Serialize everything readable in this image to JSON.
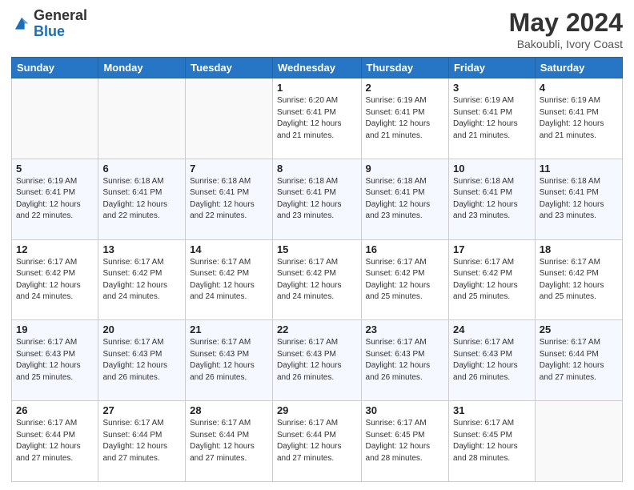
{
  "logo": {
    "general": "General",
    "blue": "Blue"
  },
  "header": {
    "title": "May 2024",
    "location": "Bakoubli, Ivory Coast"
  },
  "weekdays": [
    "Sunday",
    "Monday",
    "Tuesday",
    "Wednesday",
    "Thursday",
    "Friday",
    "Saturday"
  ],
  "weeks": [
    [
      {
        "day": "",
        "info": ""
      },
      {
        "day": "",
        "info": ""
      },
      {
        "day": "",
        "info": ""
      },
      {
        "day": "1",
        "info": "Sunrise: 6:20 AM\nSunset: 6:41 PM\nDaylight: 12 hours\nand 21 minutes."
      },
      {
        "day": "2",
        "info": "Sunrise: 6:19 AM\nSunset: 6:41 PM\nDaylight: 12 hours\nand 21 minutes."
      },
      {
        "day": "3",
        "info": "Sunrise: 6:19 AM\nSunset: 6:41 PM\nDaylight: 12 hours\nand 21 minutes."
      },
      {
        "day": "4",
        "info": "Sunrise: 6:19 AM\nSunset: 6:41 PM\nDaylight: 12 hours\nand 21 minutes."
      }
    ],
    [
      {
        "day": "5",
        "info": "Sunrise: 6:19 AM\nSunset: 6:41 PM\nDaylight: 12 hours\nand 22 minutes."
      },
      {
        "day": "6",
        "info": "Sunrise: 6:18 AM\nSunset: 6:41 PM\nDaylight: 12 hours\nand 22 minutes."
      },
      {
        "day": "7",
        "info": "Sunrise: 6:18 AM\nSunset: 6:41 PM\nDaylight: 12 hours\nand 22 minutes."
      },
      {
        "day": "8",
        "info": "Sunrise: 6:18 AM\nSunset: 6:41 PM\nDaylight: 12 hours\nand 23 minutes."
      },
      {
        "day": "9",
        "info": "Sunrise: 6:18 AM\nSunset: 6:41 PM\nDaylight: 12 hours\nand 23 minutes."
      },
      {
        "day": "10",
        "info": "Sunrise: 6:18 AM\nSunset: 6:41 PM\nDaylight: 12 hours\nand 23 minutes."
      },
      {
        "day": "11",
        "info": "Sunrise: 6:18 AM\nSunset: 6:41 PM\nDaylight: 12 hours\nand 23 minutes."
      }
    ],
    [
      {
        "day": "12",
        "info": "Sunrise: 6:17 AM\nSunset: 6:42 PM\nDaylight: 12 hours\nand 24 minutes."
      },
      {
        "day": "13",
        "info": "Sunrise: 6:17 AM\nSunset: 6:42 PM\nDaylight: 12 hours\nand 24 minutes."
      },
      {
        "day": "14",
        "info": "Sunrise: 6:17 AM\nSunset: 6:42 PM\nDaylight: 12 hours\nand 24 minutes."
      },
      {
        "day": "15",
        "info": "Sunrise: 6:17 AM\nSunset: 6:42 PM\nDaylight: 12 hours\nand 24 minutes."
      },
      {
        "day": "16",
        "info": "Sunrise: 6:17 AM\nSunset: 6:42 PM\nDaylight: 12 hours\nand 25 minutes."
      },
      {
        "day": "17",
        "info": "Sunrise: 6:17 AM\nSunset: 6:42 PM\nDaylight: 12 hours\nand 25 minutes."
      },
      {
        "day": "18",
        "info": "Sunrise: 6:17 AM\nSunset: 6:42 PM\nDaylight: 12 hours\nand 25 minutes."
      }
    ],
    [
      {
        "day": "19",
        "info": "Sunrise: 6:17 AM\nSunset: 6:43 PM\nDaylight: 12 hours\nand 25 minutes."
      },
      {
        "day": "20",
        "info": "Sunrise: 6:17 AM\nSunset: 6:43 PM\nDaylight: 12 hours\nand 26 minutes."
      },
      {
        "day": "21",
        "info": "Sunrise: 6:17 AM\nSunset: 6:43 PM\nDaylight: 12 hours\nand 26 minutes."
      },
      {
        "day": "22",
        "info": "Sunrise: 6:17 AM\nSunset: 6:43 PM\nDaylight: 12 hours\nand 26 minutes."
      },
      {
        "day": "23",
        "info": "Sunrise: 6:17 AM\nSunset: 6:43 PM\nDaylight: 12 hours\nand 26 minutes."
      },
      {
        "day": "24",
        "info": "Sunrise: 6:17 AM\nSunset: 6:43 PM\nDaylight: 12 hours\nand 26 minutes."
      },
      {
        "day": "25",
        "info": "Sunrise: 6:17 AM\nSunset: 6:44 PM\nDaylight: 12 hours\nand 27 minutes."
      }
    ],
    [
      {
        "day": "26",
        "info": "Sunrise: 6:17 AM\nSunset: 6:44 PM\nDaylight: 12 hours\nand 27 minutes."
      },
      {
        "day": "27",
        "info": "Sunrise: 6:17 AM\nSunset: 6:44 PM\nDaylight: 12 hours\nand 27 minutes."
      },
      {
        "day": "28",
        "info": "Sunrise: 6:17 AM\nSunset: 6:44 PM\nDaylight: 12 hours\nand 27 minutes."
      },
      {
        "day": "29",
        "info": "Sunrise: 6:17 AM\nSunset: 6:44 PM\nDaylight: 12 hours\nand 27 minutes."
      },
      {
        "day": "30",
        "info": "Sunrise: 6:17 AM\nSunset: 6:45 PM\nDaylight: 12 hours\nand 28 minutes."
      },
      {
        "day": "31",
        "info": "Sunrise: 6:17 AM\nSunset: 6:45 PM\nDaylight: 12 hours\nand 28 minutes."
      },
      {
        "day": "",
        "info": ""
      }
    ]
  ]
}
